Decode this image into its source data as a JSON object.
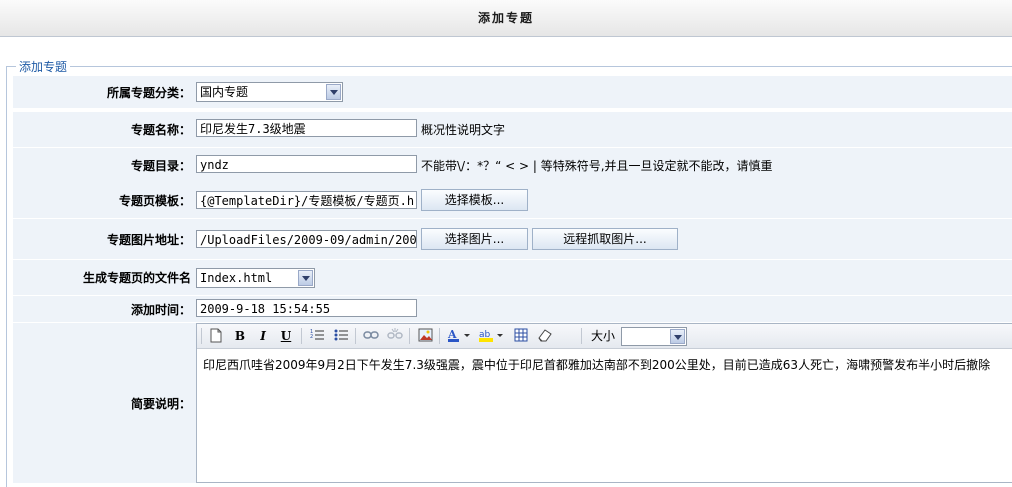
{
  "header": {
    "title": "添加专题"
  },
  "form": {
    "legend": "添加专题",
    "category": {
      "label": "所属专题分类：",
      "value": "国内专题"
    },
    "name": {
      "label": "专题名称：",
      "value": "印尼发生7.3级地震",
      "hint": "概况性说明文字"
    },
    "dir": {
      "label": "专题目录：",
      "value": "yndz",
      "hint": "不能带\\/：*？“ < > | 等特殊符号,并且一旦设定就不能改，请慎重"
    },
    "template": {
      "label": "专题页模板：",
      "value": "{@TemplateDir}/专题模板/专题页.h",
      "button": "选择模板..."
    },
    "image": {
      "label": "专题图片地址：",
      "value": "/UploadFiles/2009-09/admin/2009",
      "button_pick": "选择图片...",
      "button_remote": "远程抓取图片..."
    },
    "filename": {
      "label": "生成专题页的文件名",
      "value": "Index.html"
    },
    "time": {
      "label": "添加时间：",
      "value": "2009-9-18 15:54:55"
    },
    "summary": {
      "label": "简要说明：",
      "size_label": "大小",
      "content": "印尼西爪哇省2009年9月2日下午发生7.3级强震，震中位于印尼首都雅加达南部不到200公里处，目前已造成63人死亡，海啸预警发布半小时后撤除"
    }
  },
  "toolbar_icons": [
    "source-icon",
    "new-page-icon",
    "bold-icon",
    "italic-icon",
    "underline-icon",
    "ordered-list-icon",
    "unordered-list-icon",
    "link-icon",
    "unlink-icon",
    "image-icon",
    "font-color-icon",
    "highlight-icon",
    "table-icon",
    "eraser-icon"
  ],
  "colors": {
    "row_bg": "#eef3f9",
    "border": "#b6c6dc",
    "legend": "#1f5ba6",
    "highlight": "#ffe400",
    "font_color": "#2a56c6"
  }
}
